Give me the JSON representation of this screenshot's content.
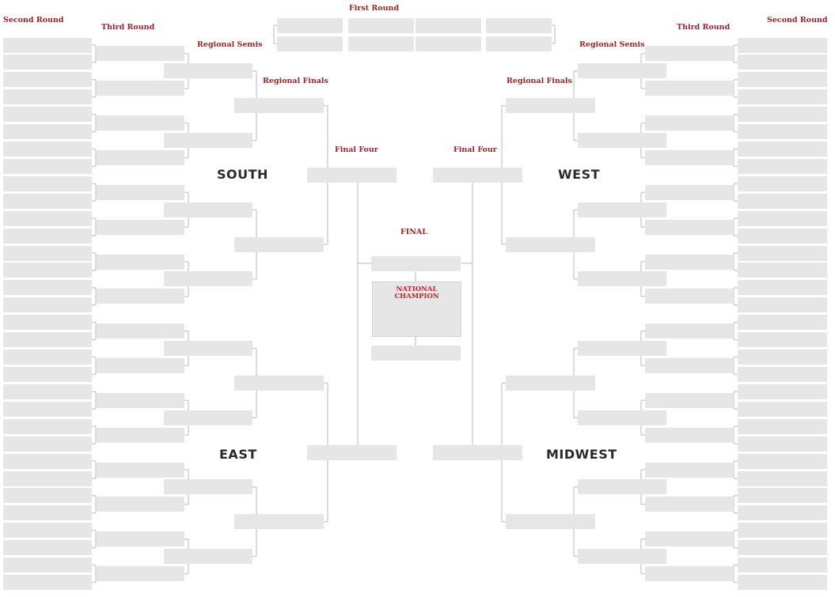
{
  "labels": {
    "first_round": "First Round",
    "second_round_left": "Second Round",
    "second_round_right": "Second Round",
    "third_round_left": "Third Round",
    "third_round_right": "Third Round",
    "regional_semis_left": "Regional Semis",
    "regional_semis_right": "Regional Semis",
    "regional_finals_left": "Regional Finals",
    "regional_finals_right": "Regional Finals",
    "final_four_left": "Final Four",
    "final_four_right": "Final Four",
    "final": "FINAL",
    "national_champion_line1": "NATIONAL",
    "national_champion_line2": "CHAMPION"
  },
  "regions": {
    "top_left": "SOUTH",
    "top_right": "WEST",
    "bottom_left": "EAST",
    "bottom_right": "MIDWEST"
  },
  "colors": {
    "label_red": "#a02128",
    "champion_red": "#c8202c",
    "slot_gray": "#e6e6e6",
    "line_gray": "#d0d0d0",
    "region_text": "#2a2a2a"
  }
}
